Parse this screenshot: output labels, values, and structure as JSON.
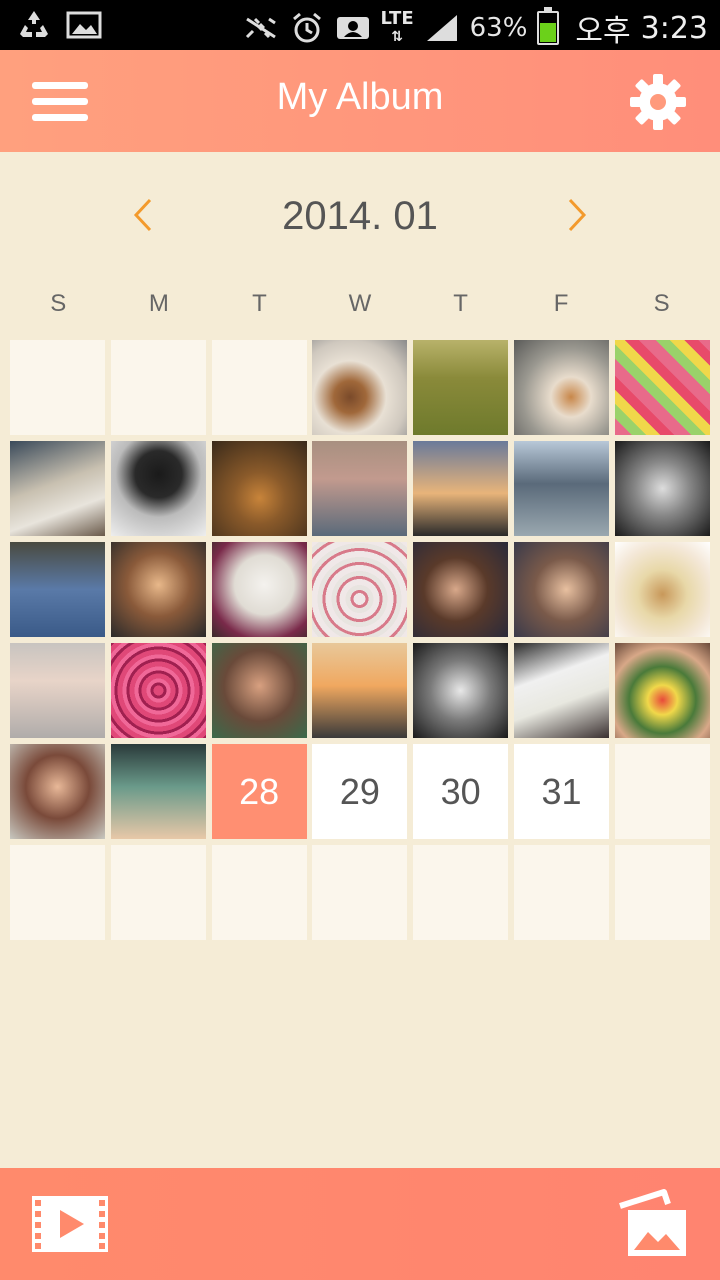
{
  "status_bar": {
    "battery_percent": "63%",
    "battery_level": 0.63,
    "network": "LTE",
    "ampm": "오후",
    "time": "3:23",
    "icons": [
      "recycle-icon",
      "image-icon",
      "nfc-icon",
      "alarm-icon",
      "account-icon",
      "lte-icon",
      "signal-icon",
      "battery-icon"
    ]
  },
  "header": {
    "title": "My Album",
    "menu_icon": "hamburger-menu-icon",
    "settings_icon": "gear-icon",
    "background_start": "#ffa07e",
    "background_end": "#ff8e7a"
  },
  "calendar": {
    "month_label": "2014. 01",
    "prev_icon": "chevron-left-icon",
    "next_icon": "chevron-right-icon",
    "weekdays": [
      "S",
      "M",
      "T",
      "W",
      "T",
      "F",
      "S"
    ],
    "days_with_photos": [
      1,
      2,
      3,
      4,
      5,
      6,
      7,
      8,
      9,
      10,
      11,
      12,
      13,
      14,
      15,
      16,
      17,
      18,
      19,
      20,
      21,
      22,
      23,
      24,
      25,
      26,
      27
    ],
    "today": "28",
    "remaining_days": [
      "29",
      "30",
      "31"
    ],
    "today_color": "#ff8f72"
  },
  "bottom_bar": {
    "video_icon": "video-play-icon",
    "gallery_icon": "photo-gallery-icon"
  },
  "colors": {
    "background": "#f5ecd6",
    "accent": "#ff8f72",
    "nav_arrow": "#f39a2c"
  }
}
